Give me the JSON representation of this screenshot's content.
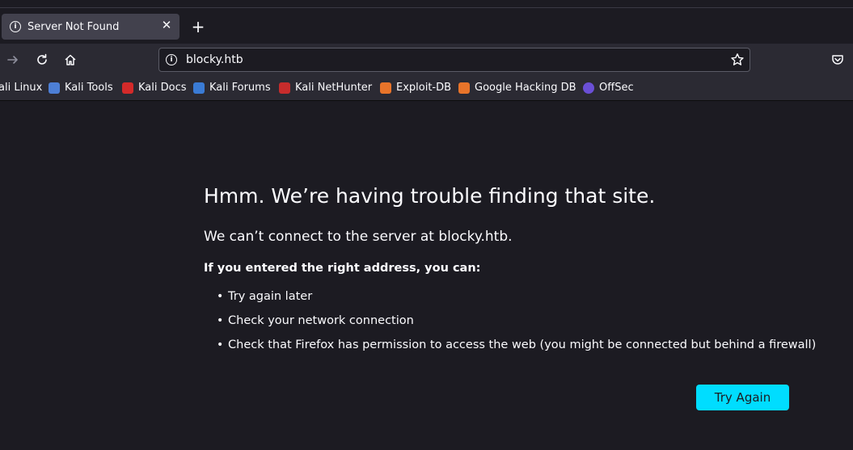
{
  "tab": {
    "title": "Server Not Found"
  },
  "urlbar": {
    "url": "blocky.htb"
  },
  "bookmarks": [
    {
      "label": "ali Linux",
      "color": "#367bf0"
    },
    {
      "label": "Kali Tools",
      "color": "#4d7fd6"
    },
    {
      "label": "Kali Docs",
      "color": "#d42a2a"
    },
    {
      "label": "Kali Forums",
      "color": "#3a7bd5"
    },
    {
      "label": "Kali NetHunter",
      "color": "#c72c2c"
    },
    {
      "label": "Exploit-DB",
      "color": "#e8742a"
    },
    {
      "label": "Google Hacking DB",
      "color": "#e8742a"
    },
    {
      "label": "OffSec",
      "color": "#6a4fd6"
    }
  ],
  "error": {
    "title": "Hmm. We’re having trouble finding that site.",
    "description": "We can’t connect to the server at blocky.htb.",
    "subtitle": "If you entered the right address, you can:",
    "suggestions": [
      "Try again later",
      "Check your network connection",
      "Check that Firefox has permission to access the web (you might be connected but behind a firewall)"
    ],
    "button": "Try Again"
  },
  "colors": {
    "accent": "#00ddff",
    "background": "#1c1b22",
    "toolbar": "#2b2a33"
  }
}
